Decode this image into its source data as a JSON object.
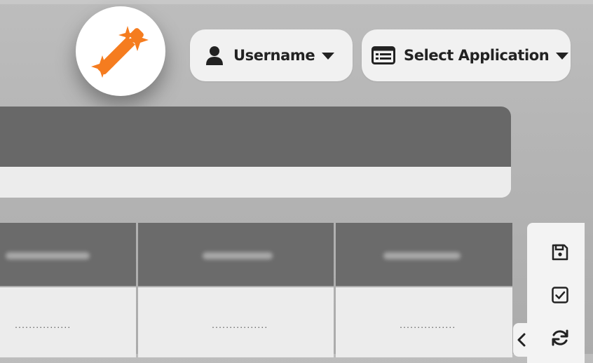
{
  "header": {
    "user_label": "Username",
    "app_label": "Select Application"
  },
  "icons": {
    "logo": "magic-wand-icon",
    "user": "user-icon",
    "app": "list-window-icon",
    "save": "save-icon",
    "check": "checkbox-icon",
    "refresh": "refresh-icon",
    "collapse": "chevron-left-icon"
  },
  "grid": {
    "cells": [
      {
        "value": "................"
      },
      {
        "value": "................"
      },
      {
        "value": "................"
      }
    ]
  },
  "colors": {
    "accent": "#f57c1f",
    "panel_dark": "#686868",
    "panel_light": "#ececec"
  }
}
